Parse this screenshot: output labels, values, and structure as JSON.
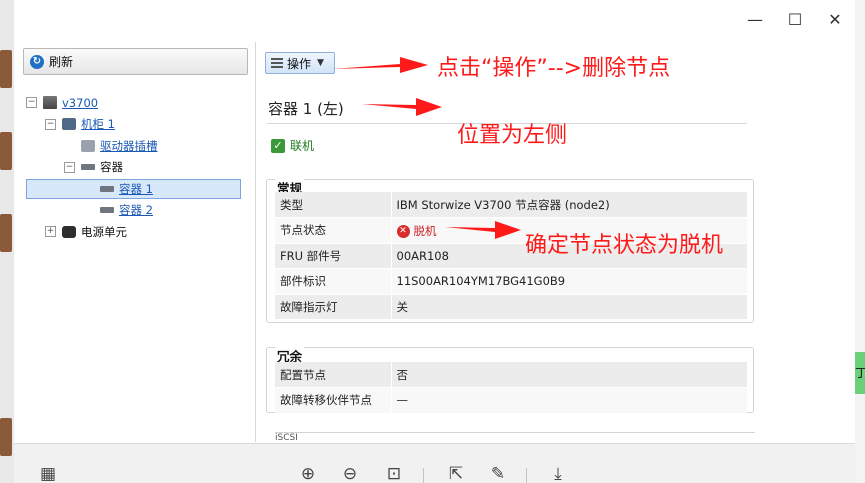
{
  "window": {
    "minimize_glyph": "—",
    "maximize_glyph": "☐",
    "close_glyph": "✕"
  },
  "left_panel": {
    "refresh_label": "刷新",
    "tree": [
      {
        "label": "v3700",
        "level": 0,
        "toggle": "−",
        "link": true,
        "icon": "server-icon"
      },
      {
        "label": "机柜 1",
        "level": 1,
        "toggle": "−",
        "link": true,
        "icon": "rack-icon"
      },
      {
        "label": "驱动器插槽",
        "level": 2,
        "toggle": "",
        "link": true,
        "icon": "drive-slot-icon"
      },
      {
        "label": "容器",
        "level": 2,
        "toggle": "−",
        "link": false,
        "icon": "enclosure-group-icon"
      },
      {
        "label": "容器 1",
        "level": 3,
        "toggle": "",
        "link": true,
        "icon": "enclosure-icon",
        "selected": true
      },
      {
        "label": "容器 2",
        "level": 3,
        "toggle": "",
        "link": true,
        "icon": "enclosure-icon"
      },
      {
        "label": "电源单元",
        "level": 1,
        "toggle": "+",
        "link": false,
        "icon": "power-supply-icon"
      }
    ]
  },
  "right_panel": {
    "actions_label": "操作",
    "enclosure_title": "容器 1 (左)",
    "online_label": "联机",
    "general": {
      "title": "常规",
      "rows": [
        {
          "key": "类型",
          "value": "IBM Storwize V3700 节点容器 (node2)"
        },
        {
          "key": "节点状态",
          "value": "脱机"
        },
        {
          "key": "FRU 部件号",
          "value": "00AR108"
        },
        {
          "key": "部件标识",
          "value": "11S00AR104YM17BG41G0B9"
        },
        {
          "key": "故障指示灯",
          "value": "关"
        }
      ]
    },
    "redundancy": {
      "title": "冗余",
      "rows": [
        {
          "key": "配置节点",
          "value": "否"
        },
        {
          "key": "故障转移伙伴节点",
          "value": "—"
        }
      ]
    },
    "next_section_peek": "iSCSI"
  },
  "bottom_toolbar": {
    "tools": [
      "grid-view-icon",
      "zoom-in-icon",
      "zoom-out-icon",
      "fit-icon",
      "export-icon",
      "edit-icon",
      "download-icon"
    ]
  },
  "annotations": {
    "action_note": "点击“操作”-->删除节点",
    "position_note": "位置为左侧",
    "status_note": "确定节点状态为脱机"
  },
  "colors": {
    "annotation_red": "#ff1a1a",
    "link_blue": "#1b58b5",
    "offline_red": "#cc1f1f",
    "online_green": "#1e7b1e"
  }
}
